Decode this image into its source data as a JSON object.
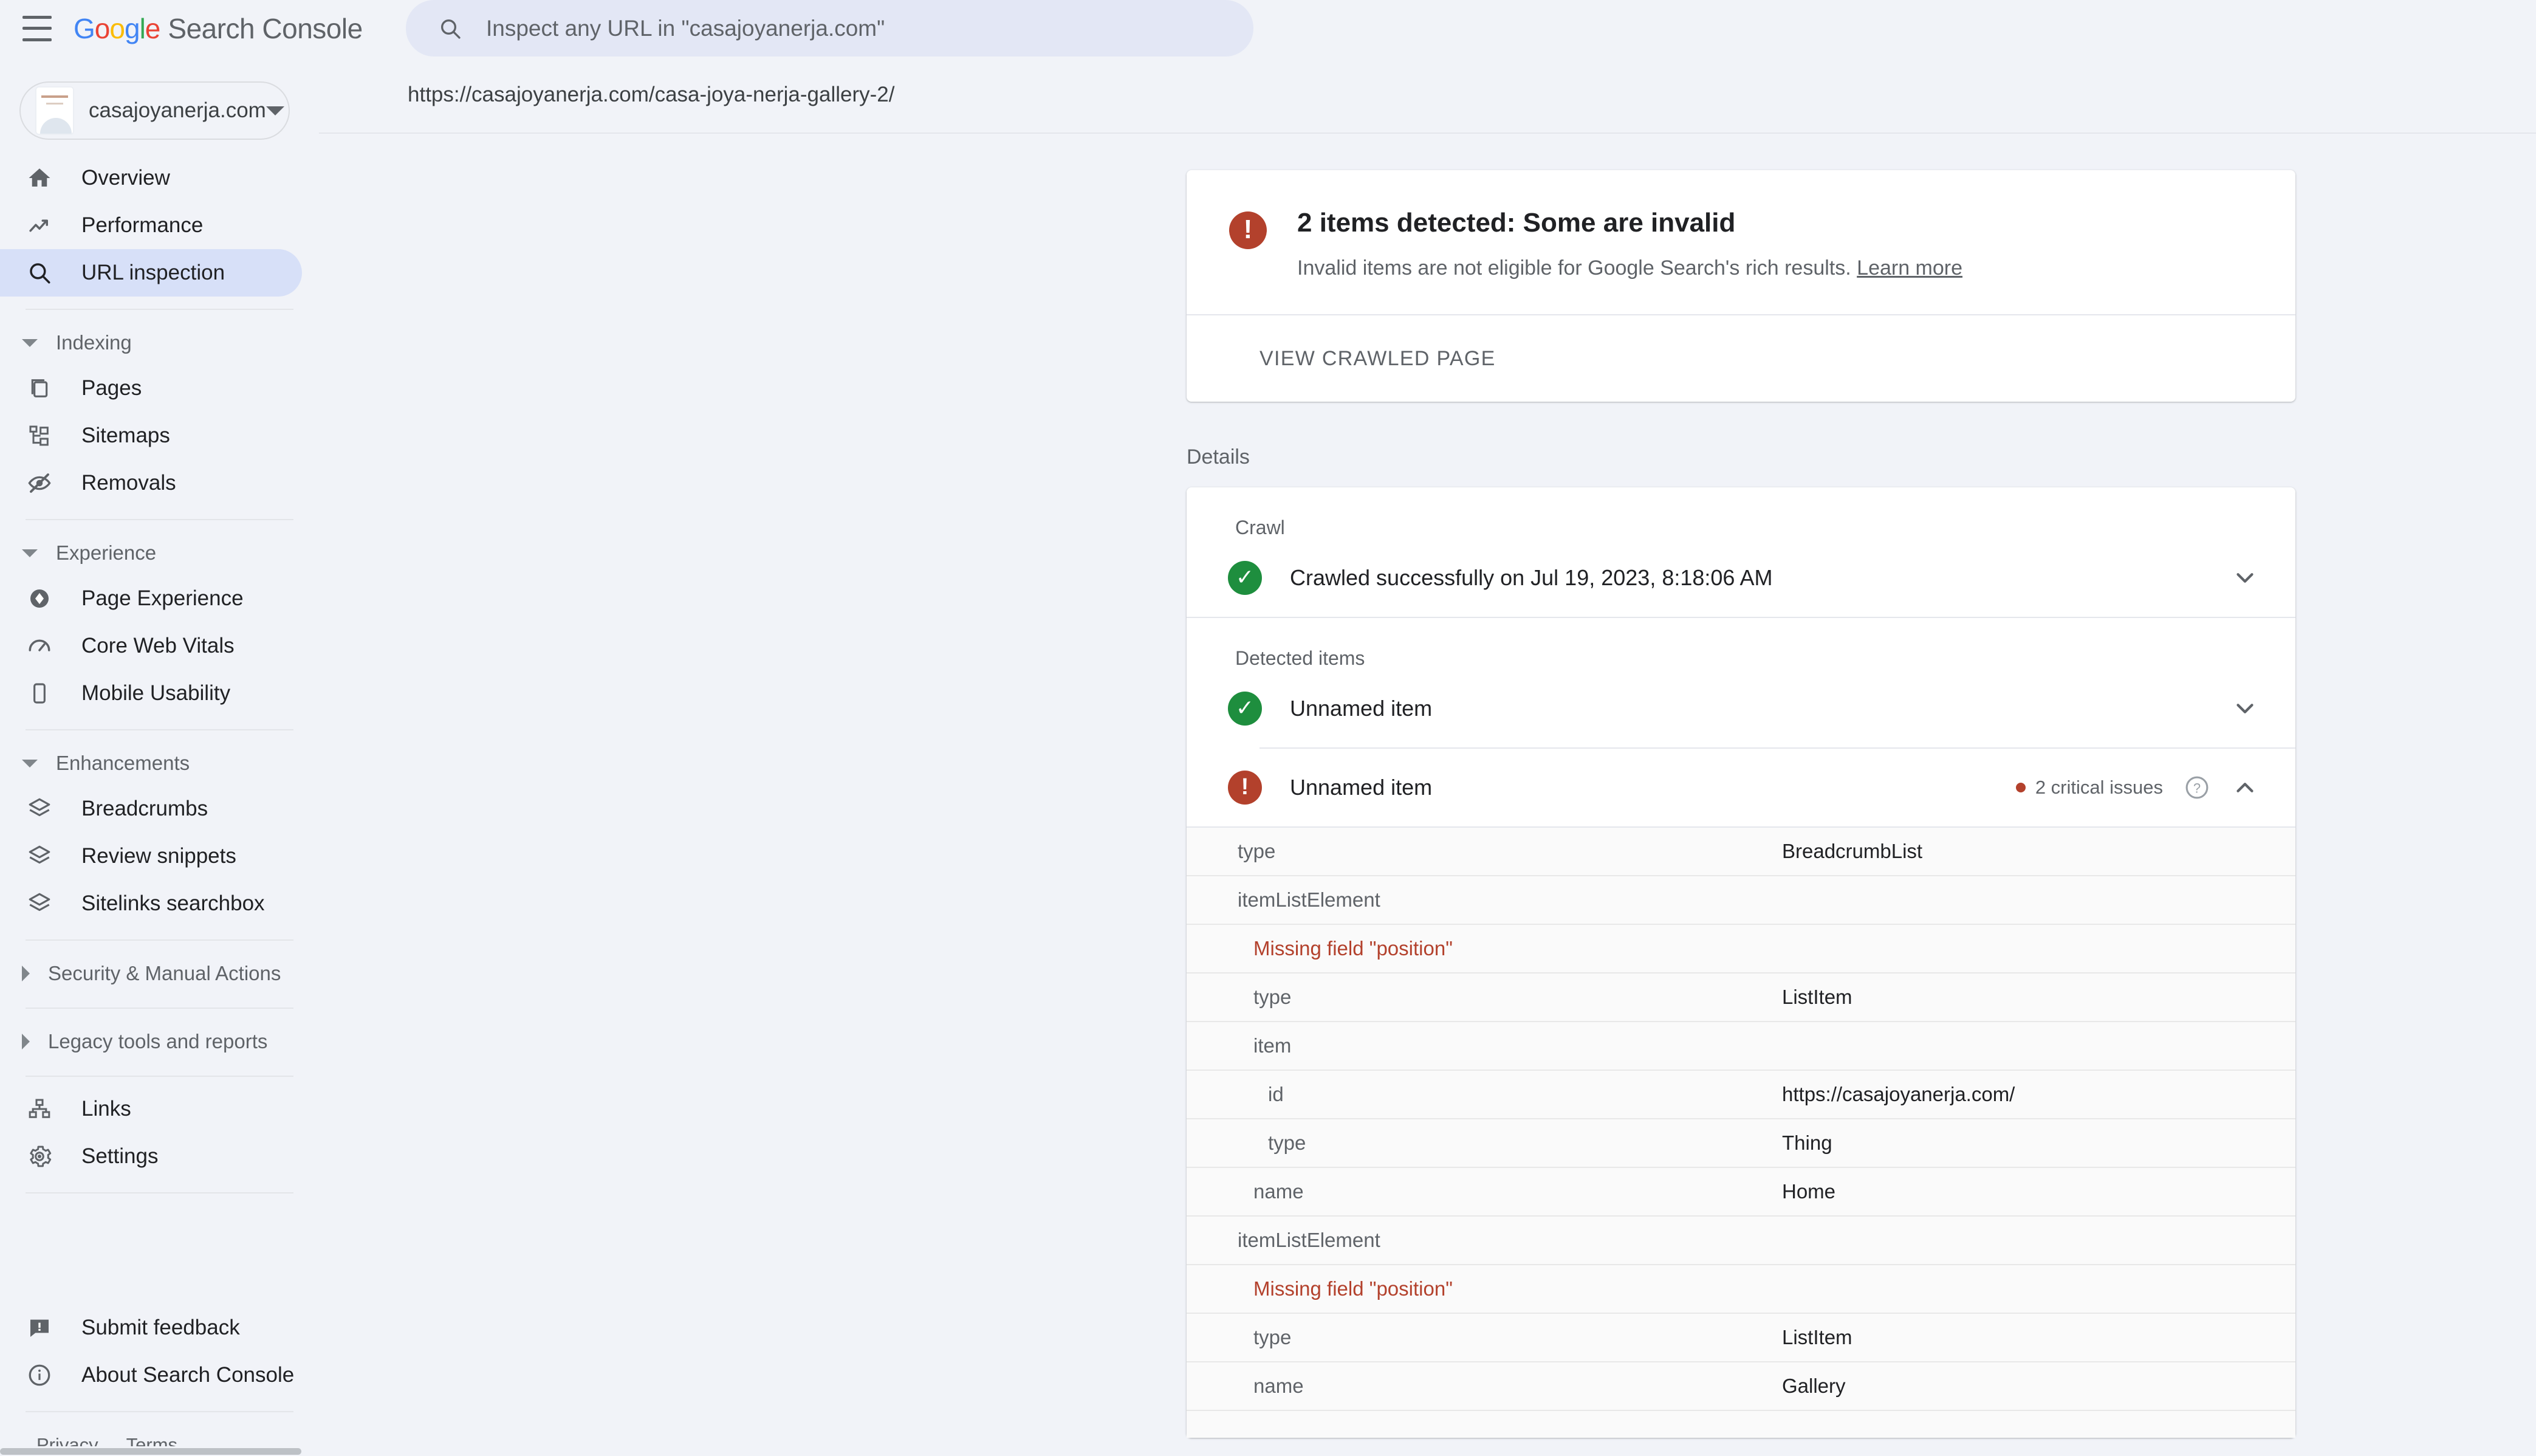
{
  "app": {
    "brand_google": "Google",
    "brand_word": "Search Console",
    "menu_icon": "hamburger-icon"
  },
  "search": {
    "placeholder": "Inspect any URL in \"casajoyanerja.com\"",
    "value": ""
  },
  "property": {
    "name": "casajoyanerja.com"
  },
  "sidebar": {
    "primary": [
      {
        "label": "Overview",
        "icon": "home-icon",
        "active": false
      },
      {
        "label": "Performance",
        "icon": "trending-up-icon",
        "active": false
      },
      {
        "label": "URL inspection",
        "icon": "search-icon",
        "active": true
      }
    ],
    "groups": [
      {
        "label": "Indexing",
        "expanded": true,
        "items": [
          {
            "label": "Pages",
            "icon": "pages-icon"
          },
          {
            "label": "Sitemaps",
            "icon": "sitemap-icon"
          },
          {
            "label": "Removals",
            "icon": "eye-off-icon"
          }
        ]
      },
      {
        "label": "Experience",
        "expanded": true,
        "items": [
          {
            "label": "Page Experience",
            "icon": "page-experience-icon"
          },
          {
            "label": "Core Web Vitals",
            "icon": "speedometer-icon"
          },
          {
            "label": "Mobile Usability",
            "icon": "mobile-icon"
          }
        ]
      },
      {
        "label": "Enhancements",
        "expanded": true,
        "items": [
          {
            "label": "Breadcrumbs",
            "icon": "layers-icon"
          },
          {
            "label": "Review snippets",
            "icon": "layers-icon"
          },
          {
            "label": "Sitelinks searchbox",
            "icon": "layers-icon"
          }
        ]
      },
      {
        "label": "Security & Manual Actions",
        "expanded": false,
        "items": []
      },
      {
        "label": "Legacy tools and reports",
        "expanded": false,
        "items": []
      }
    ],
    "tools": [
      {
        "label": "Links",
        "icon": "links-icon"
      },
      {
        "label": "Settings",
        "icon": "gear-icon"
      }
    ],
    "meta": [
      {
        "label": "Submit feedback",
        "icon": "feedback-icon"
      },
      {
        "label": "About Search Console",
        "icon": "info-icon"
      }
    ],
    "legal": [
      {
        "label": "Privacy"
      },
      {
        "label": "Terms"
      }
    ]
  },
  "main": {
    "inspected_url": "https://casajoyanerja.com/casa-joya-nerja-gallery-2/",
    "alert": {
      "icon": "error-icon",
      "title": "2 items detected: Some are invalid",
      "subtitle": "Invalid items are not eligible for Google Search's rich results.",
      "link_label": "Learn more",
      "action_label": "VIEW CRAWLED PAGE"
    },
    "details_label": "Details",
    "crawl": {
      "section_label": "Crawl",
      "status_icon": "success-icon",
      "status_text": "Crawled successfully on Jul 19, 2023, 8:18:06 AM",
      "chevron": "chevron-down-icon"
    },
    "detected_items": {
      "section_label": "Detected items",
      "items": [
        {
          "status": "ok",
          "status_icon": "success-icon",
          "label": "Unnamed item",
          "badge": "",
          "chevron": "chevron-down-icon",
          "expanded": false,
          "rows": []
        },
        {
          "status": "error",
          "status_icon": "error-icon",
          "label": "Unnamed item",
          "badge": "2 critical issues",
          "help_icon": "help-circle-icon",
          "chevron": "chevron-up-icon",
          "expanded": true,
          "rows": [
            {
              "indent": 0,
              "key": "type",
              "value": "BreadcrumbList",
              "error": false
            },
            {
              "indent": 0,
              "key": "itemListElement",
              "value": "",
              "error": false
            },
            {
              "indent": 1,
              "key": "Missing field \"position\"",
              "value": "",
              "error": true
            },
            {
              "indent": 1,
              "key": "type",
              "value": "ListItem",
              "error": false
            },
            {
              "indent": 1,
              "key": "item",
              "value": "",
              "error": false
            },
            {
              "indent": 2,
              "key": "id",
              "value": "https://casajoyanerja.com/",
              "error": false
            },
            {
              "indent": 2,
              "key": "type",
              "value": "Thing",
              "error": false
            },
            {
              "indent": 1,
              "key": "name",
              "value": "Home",
              "error": false
            },
            {
              "indent": 0,
              "key": "itemListElement",
              "value": "",
              "error": false
            },
            {
              "indent": 1,
              "key": "Missing field \"position\"",
              "value": "",
              "error": true
            },
            {
              "indent": 1,
              "key": "type",
              "value": "ListItem",
              "error": false
            },
            {
              "indent": 1,
              "key": "name",
              "value": "Gallery",
              "error": false
            }
          ]
        }
      ]
    }
  },
  "colors": {
    "error": "#b3412c",
    "success": "#1e8e3e",
    "accent": "#d7e0f8",
    "page_bg": "#f1f3f8"
  }
}
